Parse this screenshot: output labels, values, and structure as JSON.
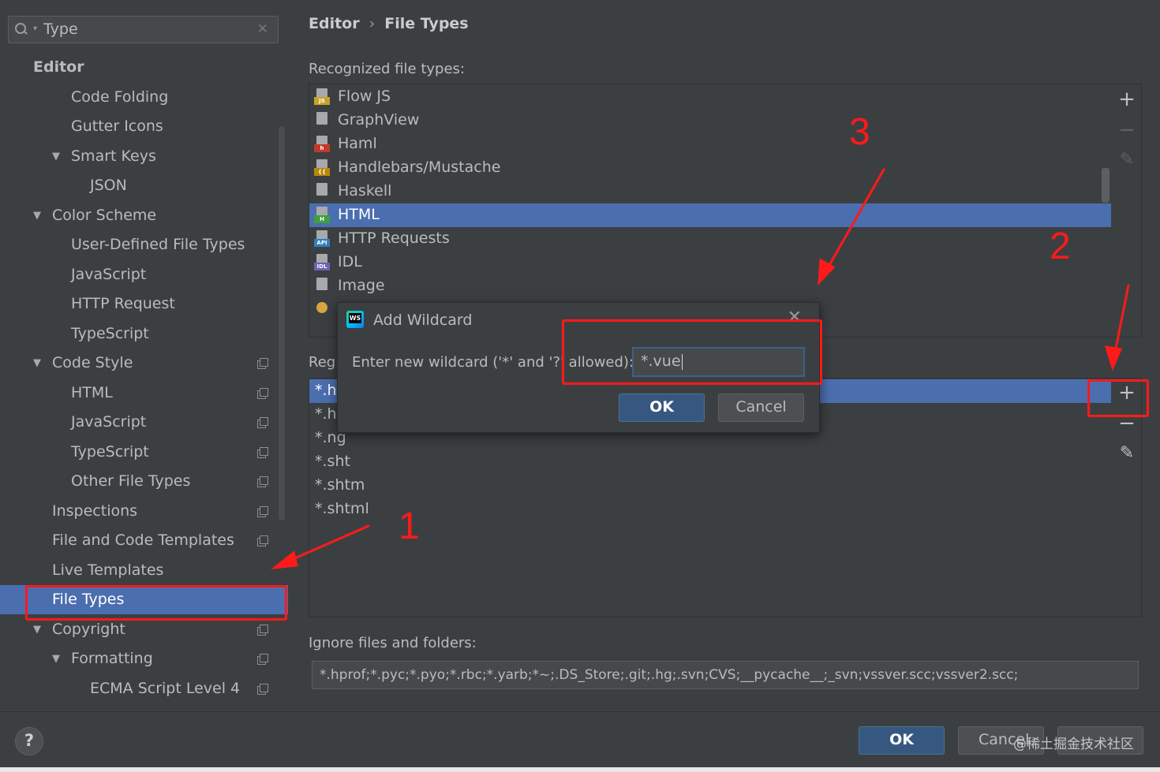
{
  "search": {
    "value": "Type"
  },
  "sidebar": {
    "items": [
      {
        "label": "Editor",
        "level": 0,
        "bold": true,
        "arrow": "",
        "copy": false,
        "selected": false
      },
      {
        "label": "Code Folding",
        "level": 2,
        "bold": false,
        "arrow": "",
        "copy": false,
        "selected": false
      },
      {
        "label": "Gutter Icons",
        "level": 2,
        "bold": false,
        "arrow": "",
        "copy": false,
        "selected": false
      },
      {
        "label": "Smart Keys",
        "level": 2,
        "bold": false,
        "arrow": "▼",
        "copy": false,
        "selected": false
      },
      {
        "label": "JSON",
        "level": 3,
        "bold": false,
        "arrow": "",
        "copy": false,
        "selected": false
      },
      {
        "label": "Color Scheme",
        "level": 1,
        "bold": false,
        "arrow": "▼",
        "copy": false,
        "selected": false
      },
      {
        "label": "User-Defined File Types",
        "level": 2,
        "bold": false,
        "arrow": "",
        "copy": false,
        "selected": false
      },
      {
        "label": "JavaScript",
        "level": 2,
        "bold": false,
        "arrow": "",
        "copy": false,
        "selected": false
      },
      {
        "label": "HTTP Request",
        "level": 2,
        "bold": false,
        "arrow": "",
        "copy": false,
        "selected": false
      },
      {
        "label": "TypeScript",
        "level": 2,
        "bold": false,
        "arrow": "",
        "copy": false,
        "selected": false
      },
      {
        "label": "Code Style",
        "level": 1,
        "bold": false,
        "arrow": "▼",
        "copy": true,
        "selected": false
      },
      {
        "label": "HTML",
        "level": 2,
        "bold": false,
        "arrow": "",
        "copy": true,
        "selected": false
      },
      {
        "label": "JavaScript",
        "level": 2,
        "bold": false,
        "arrow": "",
        "copy": true,
        "selected": false
      },
      {
        "label": "TypeScript",
        "level": 2,
        "bold": false,
        "arrow": "",
        "copy": true,
        "selected": false
      },
      {
        "label": "Other File Types",
        "level": 2,
        "bold": false,
        "arrow": "",
        "copy": true,
        "selected": false
      },
      {
        "label": "Inspections",
        "level": 1,
        "bold": false,
        "arrow": "",
        "copy": true,
        "selected": false
      },
      {
        "label": "File and Code Templates",
        "level": 1,
        "bold": false,
        "arrow": "",
        "copy": true,
        "selected": false
      },
      {
        "label": "Live Templates",
        "level": 1,
        "bold": false,
        "arrow": "",
        "copy": false,
        "selected": false
      },
      {
        "label": "File Types",
        "level": 1,
        "bold": false,
        "arrow": "",
        "copy": false,
        "selected": true
      },
      {
        "label": "Copyright",
        "level": 1,
        "bold": false,
        "arrow": "▼",
        "copy": true,
        "selected": false
      },
      {
        "label": "Formatting",
        "level": 2,
        "bold": false,
        "arrow": "▼",
        "copy": true,
        "selected": false
      },
      {
        "label": "ECMA Script Level 4",
        "level": 3,
        "bold": false,
        "arrow": "",
        "copy": true,
        "selected": false
      }
    ]
  },
  "breadcrumb": {
    "parent": "Editor",
    "separator": "›",
    "current": "File Types"
  },
  "recognized": {
    "label": "Recognized file types:",
    "items": [
      {
        "name": "Flow JS",
        "badge": "JS",
        "badge_color": "#c9a227",
        "selected": false
      },
      {
        "name": "GraphView",
        "badge": "",
        "badge_color": "",
        "selected": false
      },
      {
        "name": "Haml",
        "badge": "h",
        "badge_color": "#c0392b",
        "selected": false
      },
      {
        "name": "Handlebars/Mustache",
        "badge": "{{",
        "badge_color": "#b8860b",
        "selected": false
      },
      {
        "name": "Haskell",
        "badge": "",
        "badge_color": "",
        "selected": false
      },
      {
        "name": "HTML",
        "badge": "H",
        "badge_color": "#3f9f3f",
        "selected": true
      },
      {
        "name": "HTTP Requests",
        "badge": "API",
        "badge_color": "#2f7fc1",
        "selected": false
      },
      {
        "name": "IDL",
        "badge": "IDL",
        "badge_color": "#6f61b3",
        "selected": false
      },
      {
        "name": "Image",
        "badge": "",
        "badge_color": "",
        "selected": false
      }
    ]
  },
  "patterns": {
    "label": "Registered Patterns:",
    "items": [
      {
        "text": "*.htm",
        "selected": true
      },
      {
        "text": "*.html",
        "selected": false
      },
      {
        "text": "*.ng",
        "selected": false
      },
      {
        "text": "*.sht",
        "selected": false
      },
      {
        "text": "*.shtm",
        "selected": false
      },
      {
        "text": "*.shtml",
        "selected": false
      }
    ]
  },
  "tool_icons": {
    "add": "+",
    "remove": "−",
    "edit": "✎"
  },
  "ignore": {
    "label": "Ignore files and folders:",
    "value": "*.hprof;*.pyc;*.pyo;*.rbc;*.yarb;*~;.DS_Store;.git;.hg;.svn;CVS;__pycache__;_svn;vssver.scc;vssver2.scc;"
  },
  "dialog": {
    "title": "Add Wildcard",
    "prompt": "Enter new wildcard ('*' and '?' allowed):",
    "value": "*.vue",
    "ok": "OK",
    "cancel": "Cancel"
  },
  "footer": {
    "help": "?",
    "ok": "OK",
    "cancel": "Cancel",
    "watermark": "@稀土掘金技术社区"
  },
  "annotations": {
    "step1": "1",
    "step2": "2",
    "step3": "3",
    "color": "#ff1a1a"
  }
}
